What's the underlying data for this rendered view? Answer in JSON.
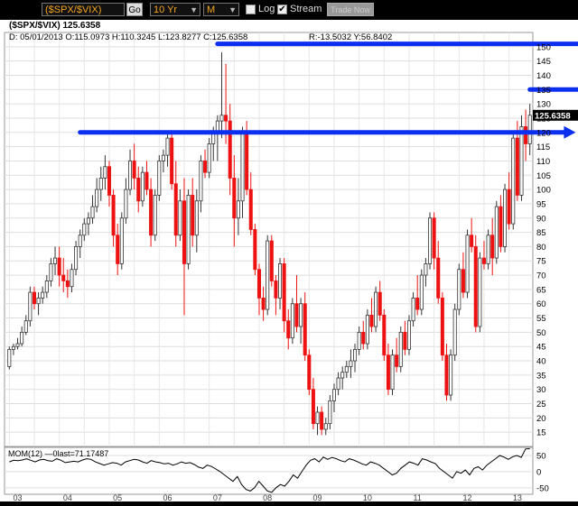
{
  "toolbar": {
    "symbol": "($SPX/$VIX)",
    "go_label": "Go",
    "period": "10 Yr",
    "frequency": "M",
    "log_label": "Log",
    "log_checked": false,
    "stream_label": "Stream",
    "stream_checked": true,
    "trade_label": "Trade Now"
  },
  "header": {
    "line1": "($SPX/$VIX)   125.6358",
    "line2_left": "D: 05/01/2013 O:115.0973 H:110.3245 L:123.8277 C:125.6358",
    "line2_right": "R:-13.5032 Y:56.8402"
  },
  "colors": {
    "up": "#ffffff",
    "down": "#ee1111",
    "arrow": "#0b2ff0",
    "label_bg": "#000000"
  },
  "chart_data": [
    {
      "type": "candlestick",
      "title": "($SPX/$VIX)",
      "ylim": [
        10,
        155
      ],
      "y_ticks": [
        15,
        20,
        25,
        30,
        35,
        40,
        45,
        50,
        55,
        60,
        65,
        70,
        75,
        80,
        85,
        90,
        95,
        100,
        105,
        110,
        115,
        120,
        125,
        130,
        135,
        140,
        145,
        150
      ],
      "x_labels": [
        "03",
        "04",
        "05",
        "06",
        "07",
        "08",
        "09",
        "10",
        "11",
        "12",
        "13"
      ],
      "last_label": "125.6358",
      "candles": [
        [
          38,
          45,
          37,
          44
        ],
        [
          44,
          46,
          42,
          45
        ],
        [
          45,
          48,
          44,
          46
        ],
        [
          46,
          52,
          45,
          50
        ],
        [
          50,
          56,
          49,
          54
        ],
        [
          54,
          66,
          52,
          64
        ],
        [
          64,
          66,
          58,
          60
        ],
        [
          60,
          64,
          56,
          62
        ],
        [
          62,
          66,
          60,
          64
        ],
        [
          64,
          70,
          62,
          68
        ],
        [
          68,
          76,
          66,
          74
        ],
        [
          74,
          80,
          70,
          76
        ],
        [
          76,
          80,
          66,
          70
        ],
        [
          70,
          76,
          64,
          68
        ],
        [
          68,
          72,
          62,
          66
        ],
        [
          66,
          74,
          64,
          72
        ],
        [
          72,
          82,
          70,
          80
        ],
        [
          80,
          86,
          76,
          84
        ],
        [
          84,
          90,
          82,
          88
        ],
        [
          88,
          92,
          84,
          90
        ],
        [
          90,
          98,
          88,
          94
        ],
        [
          94,
          104,
          92,
          100
        ],
        [
          100,
          108,
          96,
          104
        ],
        [
          104,
          112,
          100,
          108
        ],
        [
          108,
          110,
          94,
          98
        ],
        [
          98,
          100,
          80,
          84
        ],
        [
          84,
          88,
          70,
          74
        ],
        [
          74,
          92,
          72,
          90
        ],
        [
          90,
          104,
          88,
          100
        ],
        [
          100,
          114,
          98,
          110
        ],
        [
          110,
          116,
          100,
          104
        ],
        [
          104,
          108,
          92,
          96
        ],
        [
          96,
          108,
          94,
          106
        ],
        [
          106,
          110,
          98,
          100
        ],
        [
          100,
          104,
          80,
          84
        ],
        [
          84,
          100,
          82,
          98
        ],
        [
          98,
          112,
          96,
          110
        ],
        [
          110,
          114,
          106,
          112
        ],
        [
          112,
          120,
          108,
          118
        ],
        [
          118,
          120,
          100,
          102
        ],
        [
          102,
          110,
          80,
          84
        ],
        [
          84,
          100,
          82,
          96
        ],
        [
          96,
          104,
          56,
          74
        ],
        [
          74,
          100,
          72,
          98
        ],
        [
          98,
          104,
          80,
          84
        ],
        [
          84,
          100,
          78,
          96
        ],
        [
          96,
          112,
          92,
          110
        ],
        [
          110,
          114,
          104,
          106
        ],
        [
          106,
          118,
          104,
          116
        ],
        [
          116,
          122,
          110,
          120
        ],
        [
          120,
          126,
          110,
          124
        ],
        [
          124,
          148,
          118,
          126
        ],
        [
          126,
          144,
          116,
          124
        ],
        [
          124,
          130,
          98,
          104
        ],
        [
          104,
          112,
          80,
          90
        ],
        [
          90,
          104,
          84,
          96
        ],
        [
          96,
          122,
          90,
          120
        ],
        [
          120,
          124,
          98,
          100
        ],
        [
          100,
          106,
          84,
          86
        ],
        [
          86,
          88,
          70,
          72
        ],
        [
          72,
          74,
          56,
          62
        ],
        [
          62,
          66,
          54,
          58
        ],
        [
          58,
          84,
          56,
          82
        ],
        [
          82,
          84,
          66,
          68
        ],
        [
          68,
          70,
          56,
          62
        ],
        [
          62,
          76,
          58,
          74
        ],
        [
          74,
          76,
          50,
          54
        ],
        [
          54,
          58,
          44,
          48
        ],
        [
          48,
          62,
          46,
          60
        ],
        [
          60,
          70,
          50,
          52
        ],
        [
          52,
          62,
          46,
          60
        ],
        [
          60,
          64,
          40,
          42
        ],
        [
          42,
          44,
          28,
          30
        ],
        [
          30,
          34,
          16,
          18
        ],
        [
          18,
          24,
          14,
          22
        ],
        [
          22,
          24,
          14,
          16
        ],
        [
          16,
          20,
          14,
          18
        ],
        [
          18,
          28,
          16,
          26
        ],
        [
          26,
          32,
          22,
          30
        ],
        [
          30,
          36,
          28,
          34
        ],
        [
          34,
          38,
          30,
          36
        ],
        [
          36,
          40,
          34,
          38
        ],
        [
          38,
          44,
          34,
          40
        ],
        [
          40,
          46,
          36,
          44
        ],
        [
          44,
          52,
          42,
          50
        ],
        [
          50,
          54,
          44,
          46
        ],
        [
          46,
          58,
          44,
          56
        ],
        [
          56,
          62,
          50,
          52
        ],
        [
          52,
          66,
          50,
          64
        ],
        [
          64,
          68,
          54,
          56
        ],
        [
          56,
          58,
          40,
          42
        ],
        [
          42,
          46,
          28,
          30
        ],
        [
          30,
          44,
          28,
          42
        ],
        [
          42,
          48,
          36,
          38
        ],
        [
          38,
          52,
          36,
          50
        ],
        [
          50,
          54,
          42,
          44
        ],
        [
          44,
          56,
          42,
          54
        ],
        [
          54,
          64,
          52,
          62
        ],
        [
          62,
          70,
          56,
          58
        ],
        [
          58,
          72,
          56,
          70
        ],
        [
          70,
          76,
          66,
          74
        ],
        [
          74,
          92,
          72,
          90
        ],
        [
          90,
          92,
          72,
          76
        ],
        [
          76,
          82,
          60,
          62
        ],
        [
          62,
          64,
          40,
          42
        ],
        [
          42,
          46,
          26,
          28
        ],
        [
          28,
          44,
          26,
          42
        ],
        [
          42,
          60,
          40,
          58
        ],
        [
          58,
          74,
          56,
          72
        ],
        [
          72,
          78,
          62,
          64
        ],
        [
          64,
          86,
          62,
          84
        ],
        [
          84,
          90,
          78,
          80
        ],
        [
          80,
          84,
          50,
          52
        ],
        [
          52,
          78,
          50,
          76
        ],
        [
          76,
          82,
          72,
          74
        ],
        [
          74,
          86,
          72,
          84
        ],
        [
          84,
          90,
          70,
          76
        ],
        [
          76,
          96,
          74,
          94
        ],
        [
          94,
          98,
          78,
          80
        ],
        [
          80,
          102,
          78,
          100
        ],
        [
          100,
          106,
          86,
          88
        ],
        [
          88,
          120,
          86,
          118
        ],
        [
          118,
          124,
          96,
          98
        ],
        [
          98,
          126,
          96,
          122
        ],
        [
          122,
          128,
          110,
          116
        ],
        [
          116,
          130,
          112,
          126
        ]
      ],
      "indicator": {
        "label": "MOM(12)",
        "last_text": "last=71.17487",
        "zero_label": "0",
        "ylim": [
          -70,
          75
        ],
        "y_ticks": [
          50,
          0,
          -50
        ],
        "values": [
          30,
          35,
          34,
          36,
          40,
          35,
          30,
          36,
          38,
          34,
          32,
          40,
          35,
          28,
          30,
          32,
          30,
          36,
          40,
          38,
          30,
          25,
          20,
          24,
          28,
          26,
          20,
          30,
          34,
          38,
          36,
          30,
          26,
          34,
          30,
          28,
          24,
          26,
          20,
          24,
          30,
          26,
          28,
          22,
          14,
          10,
          20,
          16,
          8,
          0,
          -10,
          -20,
          -30,
          -15,
          -40,
          -55,
          -60,
          -50,
          -30,
          -45,
          -60,
          -64,
          -50,
          -40,
          -45,
          -30,
          -10,
          -20,
          0,
          20,
          35,
          40,
          30,
          45,
          38,
          44,
          40,
          34,
          30,
          40,
          36,
          30,
          24,
          20,
          30,
          26,
          20,
          10,
          0,
          -10,
          -5,
          10,
          20,
          30,
          26,
          20,
          40,
          36,
          30,
          25,
          10,
          0,
          -10,
          -20,
          0,
          -5,
          5,
          -10,
          10,
          15,
          5,
          20,
          30,
          40,
          50,
          45,
          38,
          46,
          50,
          44,
          70,
          71
        ]
      },
      "annotations": [
        {
          "type": "arrow",
          "y_value": 151,
          "start_index": 50,
          "end_index": 141
        },
        {
          "type": "arrow",
          "y_value": 135,
          "start_index": 125,
          "end_index": 141
        },
        {
          "type": "arrow",
          "y_value": 120,
          "start_index": 17,
          "end_index": 136
        }
      ]
    }
  ]
}
